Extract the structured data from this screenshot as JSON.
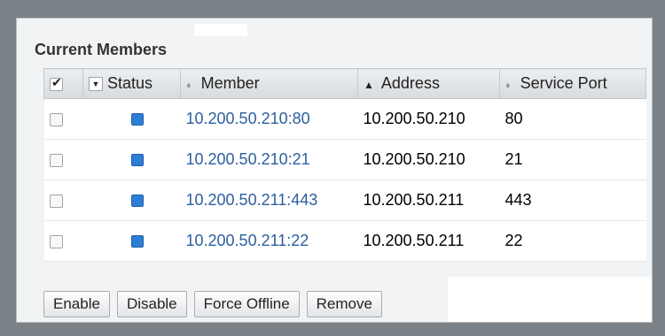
{
  "panel": {
    "title": "Current Members"
  },
  "table": {
    "columns": {
      "status": "Status",
      "member": "Member",
      "address": "Address",
      "service_port": "Service Port"
    },
    "rows": [
      {
        "member": "10.200.50.210:80",
        "address": "10.200.50.210",
        "port": "80"
      },
      {
        "member": "10.200.50.210:21",
        "address": "10.200.50.210",
        "port": "21"
      },
      {
        "member": "10.200.50.211:443",
        "address": "10.200.50.211",
        "port": "443"
      },
      {
        "member": "10.200.50.211:22",
        "address": "10.200.50.211",
        "port": "22"
      }
    ]
  },
  "actions": {
    "enable": "Enable",
    "disable": "Disable",
    "force_offline": "Force Offline",
    "remove": "Remove"
  },
  "icons": {
    "status": "status-available-icon",
    "header_checkbox": "checkbox-checked-icon",
    "sort": "sort-ascending-icon"
  },
  "colors": {
    "status_blue": "#2d7ed6",
    "member_link": "#2c5f9e"
  }
}
